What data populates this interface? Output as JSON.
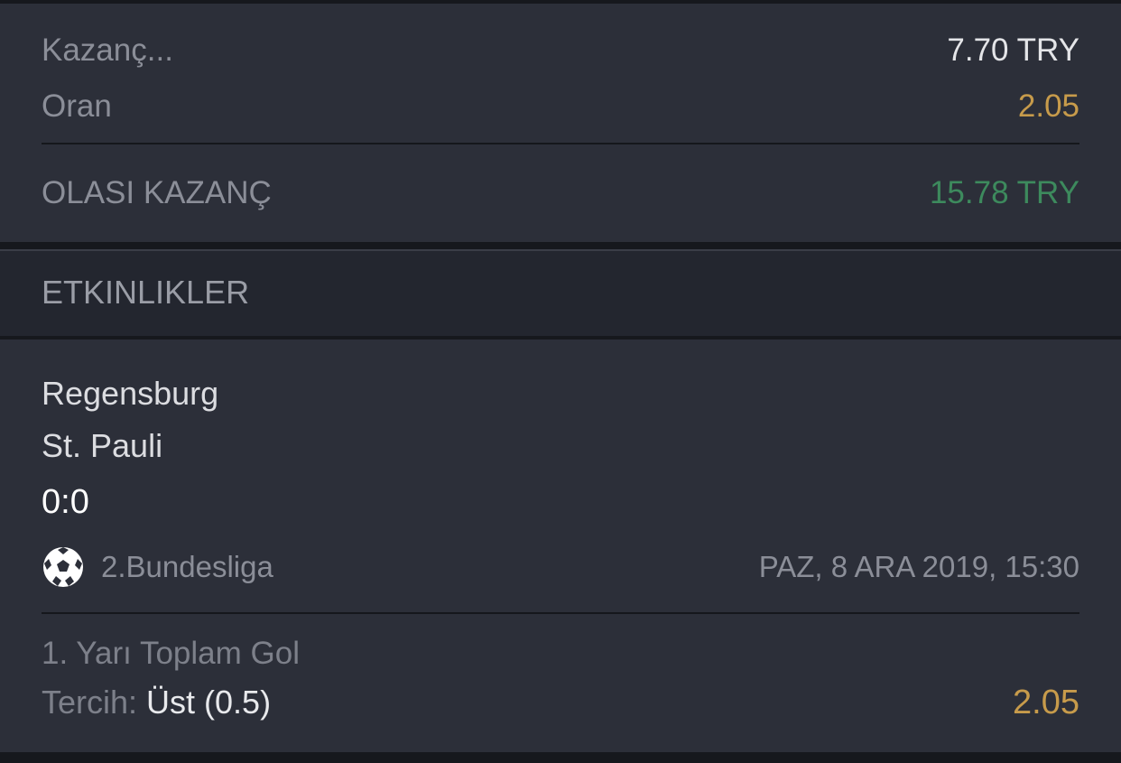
{
  "summary": {
    "stake_label": "Kazanç...",
    "stake_value": "7.70 TRY",
    "odds_label": "Oran",
    "odds_value": "2.05",
    "potential_label": "OLASI KAZANÇ",
    "potential_value": "15.78 TRY"
  },
  "events_section": {
    "title": "ETKINLIKLER"
  },
  "event": {
    "home_team": "Regensburg",
    "away_team": "St. Pauli",
    "score": "0:0",
    "sport_icon": "soccer-ball-icon",
    "league": "2.Bundesliga",
    "datetime": "PAZ, 8 ARA 2019, 15:30",
    "market": "1. Yarı Toplam Gol",
    "pick_label": "Tercih:",
    "pick_value": "Üst (0.5)",
    "pick_odds": "2.05"
  },
  "colors": {
    "background": "#2c2f39",
    "odds_gold": "#c79b4b",
    "win_green": "#3d8a5d"
  }
}
